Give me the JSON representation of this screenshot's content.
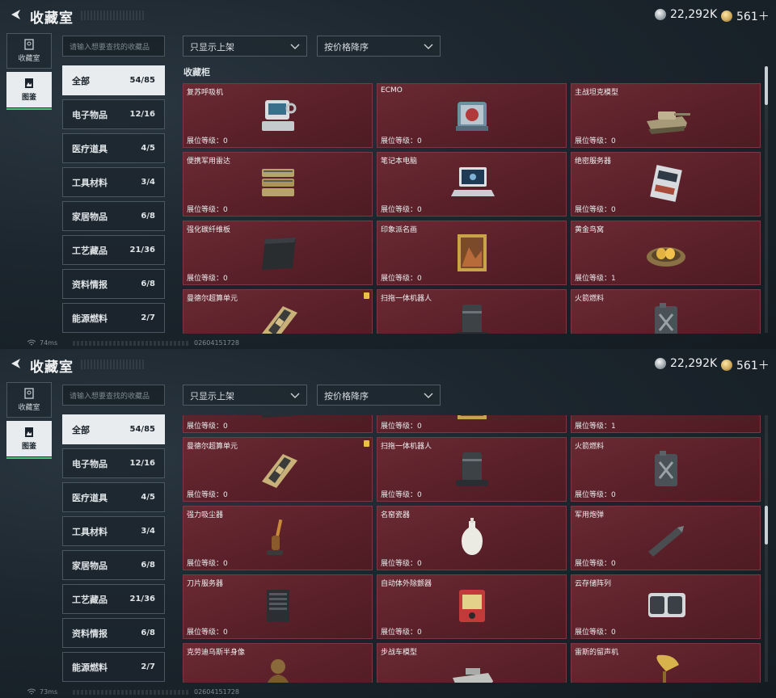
{
  "header": {
    "title": "收藏室",
    "currency_silver": "22,292K",
    "currency_gold": "561＋"
  },
  "side_tabs": [
    {
      "label": "收藏室",
      "icon": "cabinet-icon"
    },
    {
      "label": "图鉴",
      "icon": "album-icon"
    }
  ],
  "search": {
    "placeholder": "请输入想要查找的收藏品"
  },
  "filters": {
    "availability": "只显示上架",
    "sort": "按价格降序"
  },
  "categories": [
    {
      "label": "全部",
      "count": "54/85"
    },
    {
      "label": "电子物品",
      "count": "12/16"
    },
    {
      "label": "医疗道具",
      "count": "4/5"
    },
    {
      "label": "工具材料",
      "count": "3/4"
    },
    {
      "label": "家居物品",
      "count": "6/8"
    },
    {
      "label": "工艺藏品",
      "count": "21/36"
    },
    {
      "label": "资料情报",
      "count": "6/8"
    },
    {
      "label": "能源燃料",
      "count": "2/7"
    }
  ],
  "section_label": "收藏柜",
  "level_label": "展位等级：",
  "items": [
    {
      "name": "复苏呼吸机",
      "level": "0",
      "icon": "ventilator-icon"
    },
    {
      "name": "ECMO",
      "level": "0",
      "icon": "ecmo-icon"
    },
    {
      "name": "主战坦克模型",
      "level": "0",
      "icon": "tank-model-icon"
    },
    {
      "name": "便携军用雷达",
      "level": "0",
      "icon": "radar-icon"
    },
    {
      "name": "笔记本电脑",
      "level": "0",
      "icon": "laptop-icon"
    },
    {
      "name": "绝密服务器",
      "level": "0",
      "icon": "server-icon"
    },
    {
      "name": "强化碳纤维板",
      "level": "0",
      "icon": "carbon-plate-icon"
    },
    {
      "name": "印象派名画",
      "level": "0",
      "icon": "painting-icon"
    },
    {
      "name": "黄金鸟窝",
      "level": "1",
      "icon": "golden-nest-icon"
    },
    {
      "name": "曼德尔超算单元",
      "level": "0",
      "icon": "compute-unit-icon",
      "flag": true
    },
    {
      "name": "扫拖一体机器人",
      "level": "0",
      "icon": "robot-vacuum-icon"
    },
    {
      "name": "火箭燃料",
      "level": "0",
      "icon": "fuel-can-icon"
    },
    {
      "name": "强力吸尘器",
      "level": "0",
      "icon": "vacuum-cleaner-icon"
    },
    {
      "name": "名窑瓷器",
      "level": "0",
      "icon": "porcelain-vase-icon"
    },
    {
      "name": "军用炮弹",
      "level": "0",
      "icon": "artillery-shell-icon"
    },
    {
      "name": "刀片服务器",
      "level": "0",
      "icon": "blade-server-icon"
    },
    {
      "name": "自动体外除颤器",
      "level": "0",
      "icon": "defibrillator-icon"
    },
    {
      "name": "云存储阵列",
      "level": "0",
      "icon": "storage-array-icon"
    },
    {
      "name": "克劳迪乌斯半身像",
      "level": "",
      "icon": "bust-icon"
    },
    {
      "name": "步战车模型",
      "level": "",
      "icon": "ifv-model-icon"
    },
    {
      "name": "雷斯的留声机",
      "level": "",
      "icon": "gramophone-icon"
    }
  ],
  "status": {
    "ping_top": "74ms",
    "ping_bottom": "73ms",
    "uid": "02604151728"
  },
  "colors": {
    "card_bg": "#5a2029",
    "accent_green": "#4fc07a",
    "active_tab": "#e9ecee"
  }
}
